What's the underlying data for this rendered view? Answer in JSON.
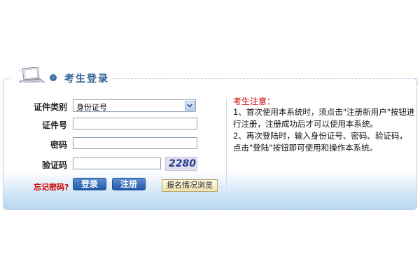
{
  "header": {
    "title": "考生登录",
    "laptop_icon": "laptop-icon",
    "arrow_icon": "circle-arrow-icon"
  },
  "form": {
    "id_type_label": "证件类别",
    "id_type_value": "身份证号",
    "id_number_label": "证件号",
    "id_number_value": "",
    "password_label": "密码",
    "password_value": "",
    "captcha_label": "验证码",
    "captcha_value": "",
    "captcha_image_text": "2280",
    "forgot_password": "忘记密码?",
    "login_button": "登录",
    "register_button": "注册",
    "browse_button": "报名情况浏览"
  },
  "notice": {
    "title": "考生注意：",
    "items": [
      "1、首次使用本系统时，须点击\"注册新用户\"按钮进行注册，注册成功后才可以使用本系统。",
      "2、再次登陆时，输入身份证号、密码、验证码，点击\"登陆\"按钮即可使用和操作本系统。"
    ]
  },
  "colors": {
    "title": "#2f5d93",
    "accent_red": "#cc0000",
    "button_blue": "#1f5aa8",
    "panel_border": "#b9d2ea"
  }
}
